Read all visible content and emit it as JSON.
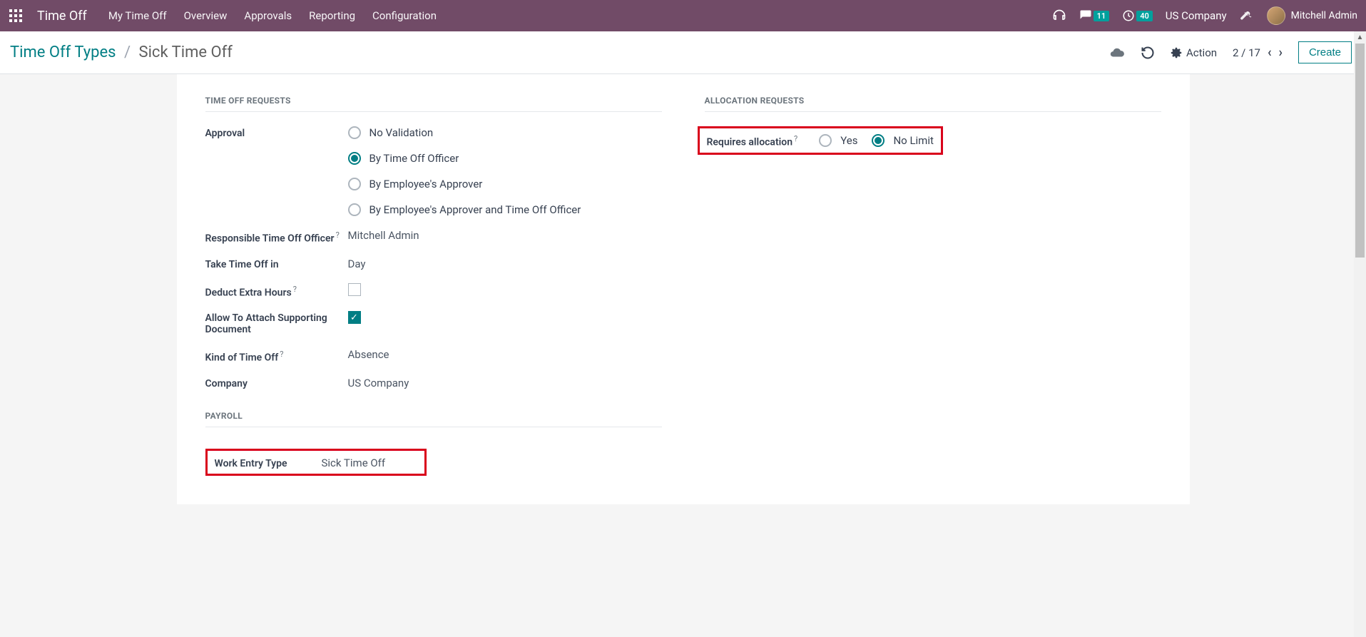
{
  "navbar": {
    "app_title": "Time Off",
    "menu": [
      "My Time Off",
      "Overview",
      "Approvals",
      "Reporting",
      "Configuration"
    ],
    "msg_count": "11",
    "clock_count": "40",
    "company": "US Company",
    "user_name": "Mitchell Admin"
  },
  "breadcrumb": {
    "parent": "Time Off Types",
    "current": "Sick Time Off"
  },
  "controlbar": {
    "action_label": "Action",
    "pager": "2 / 17",
    "create_label": "Create"
  },
  "sections": {
    "time_off_requests_title": "TIME OFF REQUESTS",
    "allocation_requests_title": "ALLOCATION REQUESTS",
    "payroll_title": "PAYROLL"
  },
  "fields": {
    "approval_label": "Approval",
    "approval_options": {
      "no_validation": "No Validation",
      "by_officer": "By Time Off Officer",
      "by_approver": "By Employee's Approver",
      "by_both": "By Employee's Approver and Time Off Officer"
    },
    "approval_selected": "by_officer",
    "responsible_label": "Responsible Time Off Officer",
    "responsible_value": "Mitchell Admin",
    "take_in_label": "Take Time Off in",
    "take_in_value": "Day",
    "deduct_label": "Deduct Extra Hours",
    "deduct_checked": false,
    "attach_label": "Allow To Attach Supporting Document",
    "attach_checked": true,
    "kind_label": "Kind of Time Off",
    "kind_value": "Absence",
    "company_label": "Company",
    "company_value": "US Company",
    "requires_alloc_label": "Requires allocation",
    "alloc_options": {
      "yes": "Yes",
      "no_limit": "No Limit"
    },
    "alloc_selected": "no_limit",
    "work_entry_label": "Work Entry Type",
    "work_entry_value": "Sick Time Off"
  }
}
